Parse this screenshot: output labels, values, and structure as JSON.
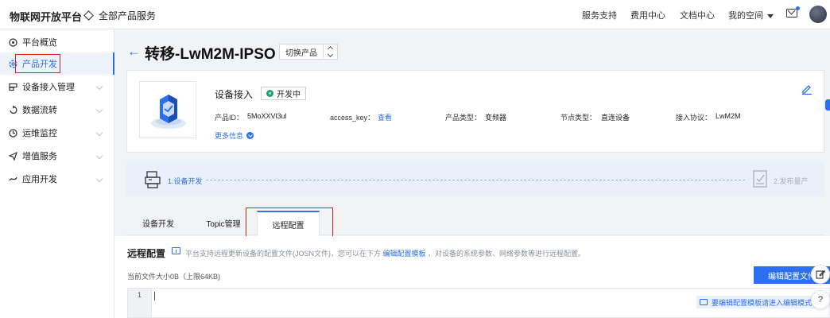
{
  "topbar": {
    "brand": "物联网开放平台",
    "all_products": "全部产品服务",
    "nav": [
      "服务支持",
      "费用中心",
      "文档中心",
      "我的空间"
    ]
  },
  "sidebar": {
    "items": [
      {
        "label": "平台概览",
        "icon": "circle-icon"
      },
      {
        "label": "产品开发",
        "icon": "settings-icon"
      },
      {
        "label": "设备接入管理",
        "icon": "device-icon"
      },
      {
        "label": "数据流转",
        "icon": "flow-icon"
      },
      {
        "label": "运维监控",
        "icon": "monitor-icon"
      },
      {
        "label": "增值服务",
        "icon": "send-icon"
      },
      {
        "label": "应用开发",
        "icon": "code-icon"
      }
    ]
  },
  "header": {
    "title": "转移-LwM2M-IPSO",
    "switch_label": "切换产品"
  },
  "product": {
    "section_label": "设备接入",
    "status": "开发中",
    "fields": {
      "id_label": "产品ID：",
      "id_value": "5MoXXVl3ul",
      "key_label": "access_key：",
      "key_link": "查看",
      "type_label": "产品类型：",
      "type_value": "变频器",
      "node_label": "节点类型：",
      "node_value": "直连设备",
      "protocol_label": "接入协议：",
      "protocol_value": "LwM2M"
    },
    "more": "更多信息"
  },
  "steps": {
    "step1": "1.设备开发",
    "step2": "2.发布量产"
  },
  "tabs": [
    "设备开发",
    "Topic管理",
    "远程配置"
  ],
  "remote_config": {
    "title": "远程配置",
    "desc_before": "平台支持远程更新设备的配置文件(JOSN文件)，您可以在下方",
    "desc_link": "编辑配置模板",
    "desc_after": "，对设备的系统参数、网络参数等进行远程配置。",
    "file_size": "当前文件大小0B（上限64KB)",
    "edit_button": "编辑配置文件",
    "line_number": "1",
    "hint": "要编辑配置模板请进入编辑模式"
  },
  "colors": {
    "accent": "#2c6fef",
    "highlight": "#e02020",
    "status_green": "#1aa56b"
  }
}
